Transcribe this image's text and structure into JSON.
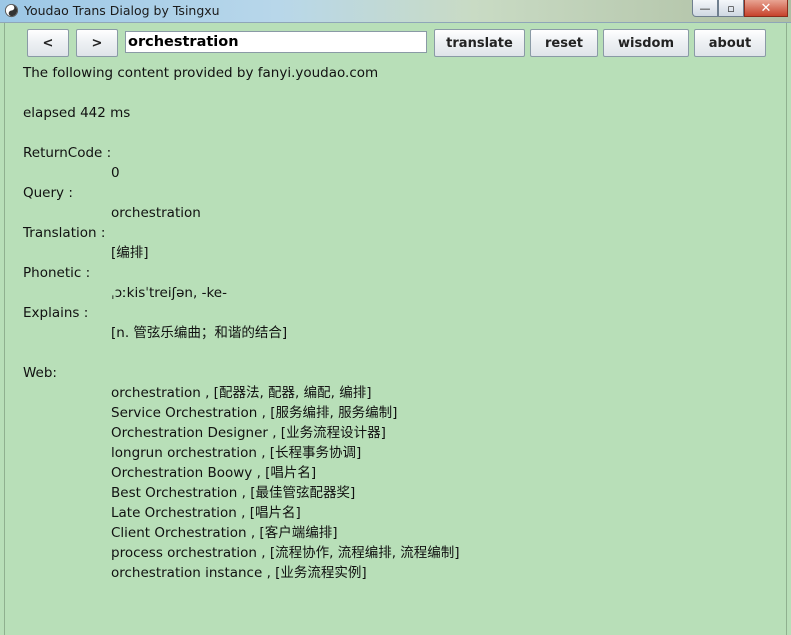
{
  "window": {
    "title": "Youdao Trans Dialog by Tsingxu",
    "buttons": {
      "minimize": "—",
      "maximize": "▫",
      "close": "✕"
    }
  },
  "toolbar": {
    "prev_label": "<",
    "next_label": ">",
    "query_value": "orchestration",
    "translate_label": "translate",
    "reset_label": "reset",
    "wisdom_label": "wisdom",
    "about_label": "about"
  },
  "result": {
    "provider_line": "The following content provided by fanyi.youdao.com",
    "elapsed": "elapsed 442 ms",
    "returncode_label": "ReturnCode :",
    "returncode_value": "0",
    "query_label": "Query :",
    "query_value": "orchestration",
    "translation_label": "Translation :",
    "translation_value": "[编排]",
    "phonetic_label": "Phonetic :",
    "phonetic_value": "ˌɔːkisˈtreiʃən, -ke-",
    "explains_label": "Explains :",
    "explains_value": "[n. 管弦乐编曲；和谐的结合]",
    "web_label": "Web:",
    "web_items": [
      "orchestration , [配器法, 配器, 编配, 编排]",
      "Service Orchestration , [服务编排, 服务编制]",
      "Orchestration Designer , [业务流程设计器]",
      "longrun orchestration , [长程事务协调]",
      "Orchestration Boowy , [唱片名]",
      "Best Orchestration , [最佳管弦配器奖]",
      "Late Orchestration , [唱片名]",
      "Client Orchestration , [客户端编排]",
      "process orchestration , [流程协作, 流程编排, 流程编制]",
      "orchestration instance , [业务流程实例]"
    ]
  }
}
